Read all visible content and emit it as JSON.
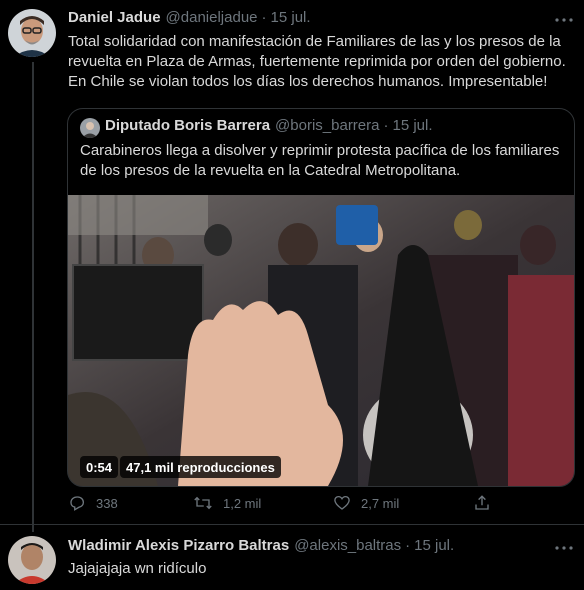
{
  "tweet": {
    "author_name": "Daniel Jadue",
    "author_handle": "@danieljadue",
    "separator": "·",
    "date": "15 jul.",
    "text": "Total solidaridad con manifestación de Familiares de las y los presos de la revuelta en Plaza de Armas, fuertemente reprimida por orden del gobierno. En Chile se violan todos los días los derechos humanos. Impresentable!",
    "quote": {
      "author_name": "Diputado Boris Barrera",
      "author_handle": "@boris_barrera",
      "date": "15 jul.",
      "text": "Carabineros llega a disolver y reprimir protesta pacífica de los familiares de los presos de la revuelta en la Catedral Metropolitana.",
      "video": {
        "duration": "0:54",
        "views": "47,1 mil reproducciones"
      }
    },
    "actions": {
      "replies": "338",
      "retweets": "1,2 mil",
      "likes": "2,7 mil"
    }
  },
  "reply": {
    "author_name": "Wladimir Alexis Pizarro Baltras",
    "author_handle": "@alexis_baltras",
    "separator": "·",
    "date": "15 jul.",
    "text": "Jajajajaja wn ridículo"
  },
  "colors": {
    "background": "#000000",
    "text": "#d9d9d9",
    "secondary": "#6e767d",
    "border": "#2f3336"
  }
}
